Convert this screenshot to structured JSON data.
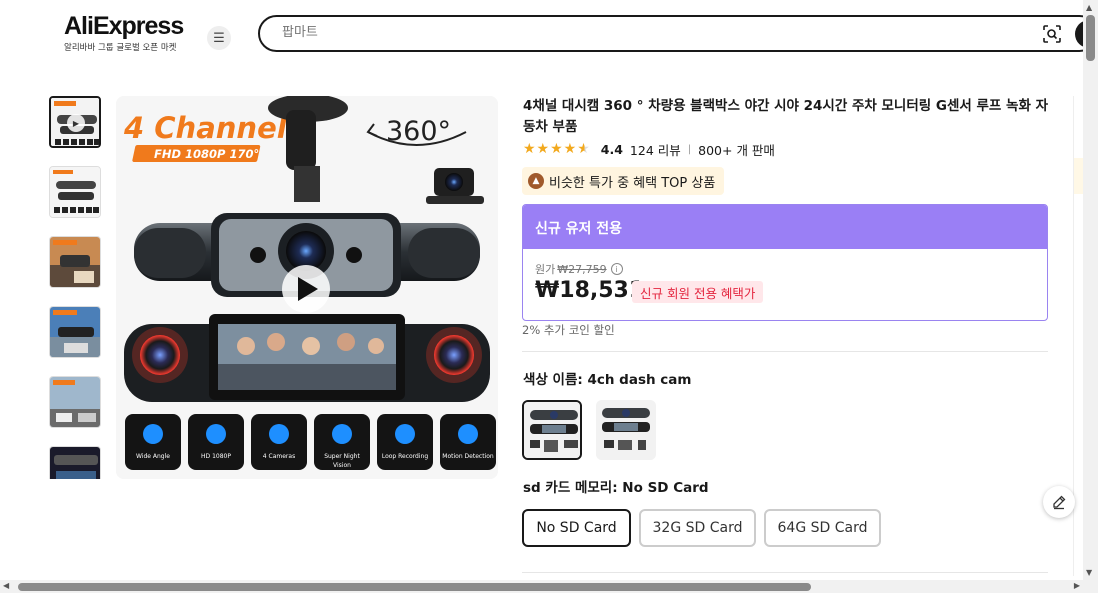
{
  "header": {
    "logo": "AliExpress",
    "logo_sub": "알리바바 그룹 글로벌 오픈 마켓",
    "search_placeholder": "팝마트"
  },
  "gallery": {
    "thumbnail_count": 6,
    "main_image": {
      "headline": "4 Channels",
      "spec": "FHD 1080P 170°",
      "rotation": "360°",
      "features": [
        "Wide Angle",
        "HD 1080P",
        "4 Cameras",
        "Super Night Vision",
        "Loop Recording",
        "Motion Detection"
      ]
    }
  },
  "product": {
    "title": "4채널 대시캠 360 ° 차량용 블랙박스 야간 시야 24시간 주차 모니터링 G센서 루프 녹화 자동차 부품",
    "rating": "4.4",
    "rating_fraction": 0.88,
    "reviews": "124 리뷰",
    "sold": "800+ 개 판매",
    "badge": "비슷한 특가 중 혜택 TOP 상품"
  },
  "promo": {
    "header": "신규 유저 전용",
    "orig_label": "원가",
    "orig_price": "₩27,759",
    "price": "₩18,531",
    "tag": "신규 회원 전용 혜택가",
    "coin_text": "2% 추가 코인 할인"
  },
  "options": {
    "color_label": "색상 이름: 4ch dash cam",
    "sd_label": "sd 카드 메모리: No SD Card",
    "sd_options": [
      "No SD Card",
      "32G SD Card",
      "64G SD Card"
    ]
  },
  "colors": {
    "promo_purple": "#9a7ff5",
    "star": "#f2a91e",
    "price_tag_red": "#e4263f",
    "banner_orange": "#f07a1c"
  }
}
